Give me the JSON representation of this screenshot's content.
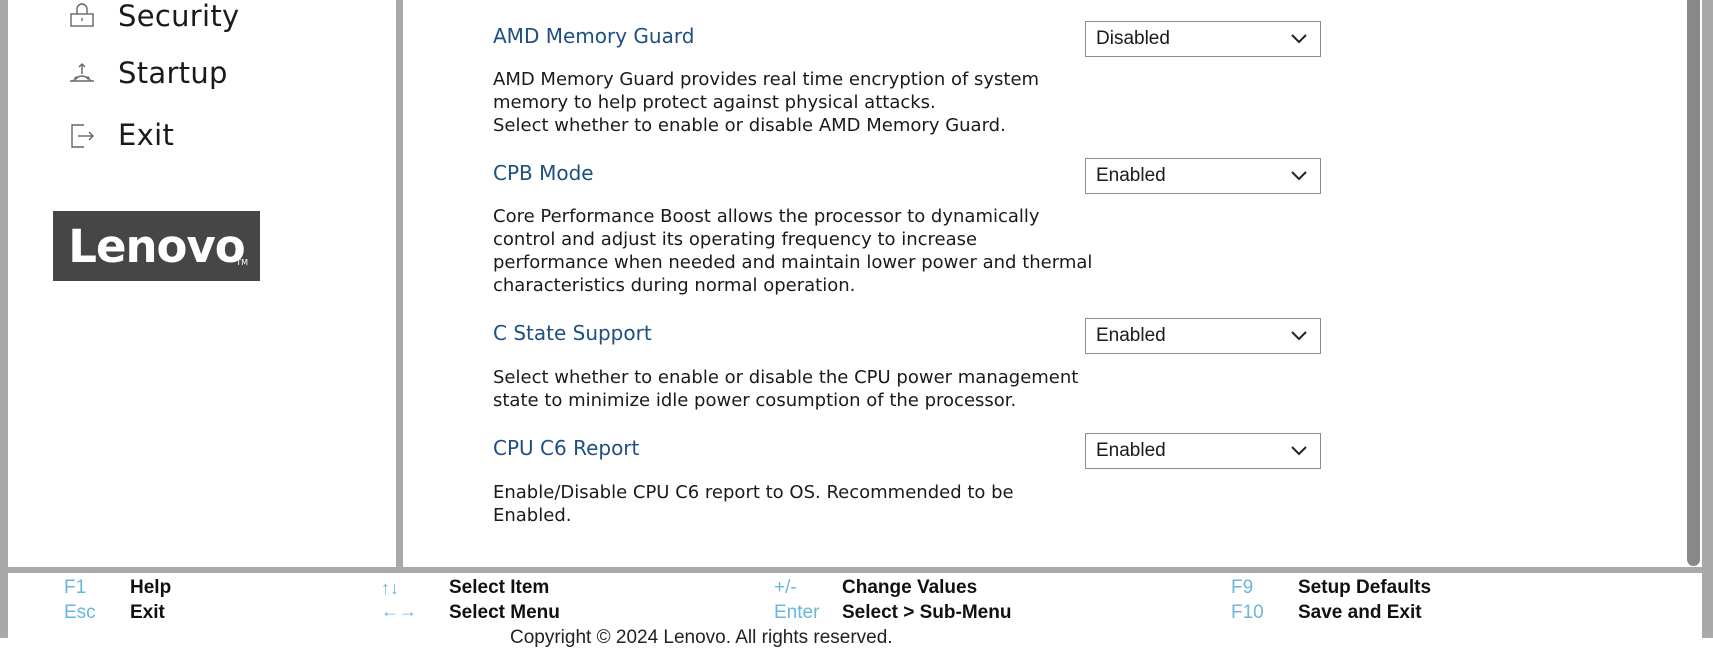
{
  "sidebar": {
    "items": [
      {
        "label": "Security",
        "icon": "lock-icon"
      },
      {
        "label": "Startup",
        "icon": "startup-icon"
      },
      {
        "label": "Exit",
        "icon": "exit-icon"
      }
    ],
    "logo": {
      "text": "Lenovo",
      "tm": "TM"
    }
  },
  "settings": [
    {
      "title": "AMD Memory Guard",
      "value": "Disabled",
      "description": "AMD Memory Guard provides real time encryption of system memory to help protect against physical attacks.\nSelect whether to enable or disable AMD Memory Guard."
    },
    {
      "title": "CPB Mode",
      "value": "Enabled",
      "description": "Core Performance Boost allows the processor to dynamically control and adjust its operating frequency to increase performance when needed and maintain lower power and thermal characteristics during normal operation."
    },
    {
      "title": "C State Support",
      "value": "Enabled",
      "description": "Select whether to enable or disable the CPU power management state to minimize idle power cosumption of the processor."
    },
    {
      "title": "CPU C6 Report",
      "value": "Enabled",
      "description": "Enable/Disable CPU C6 report to OS. Recommended to be Enabled."
    }
  ],
  "footer": {
    "f1_key": "F1",
    "f1_action": "Help",
    "esc_key": "Esc",
    "esc_action": "Exit",
    "updown_key": "↑↓",
    "updown_action": "Select Item",
    "leftright_key": "←→",
    "leftright_action": "Select Menu",
    "plusminus_key": "+/-",
    "plusminus_action": "Change Values",
    "enter_key": "Enter",
    "enter_action": "Select > Sub-Menu",
    "f9_key": "F9",
    "f9_action": "Setup Defaults",
    "f10_key": "F10",
    "f10_action": "Save and Exit",
    "copyright": "Copyright © 2024 Lenovo. All rights reserved."
  },
  "colors": {
    "title": "#1f4e82",
    "key": "#6bb6dc",
    "frame": "#a9a9a9"
  }
}
